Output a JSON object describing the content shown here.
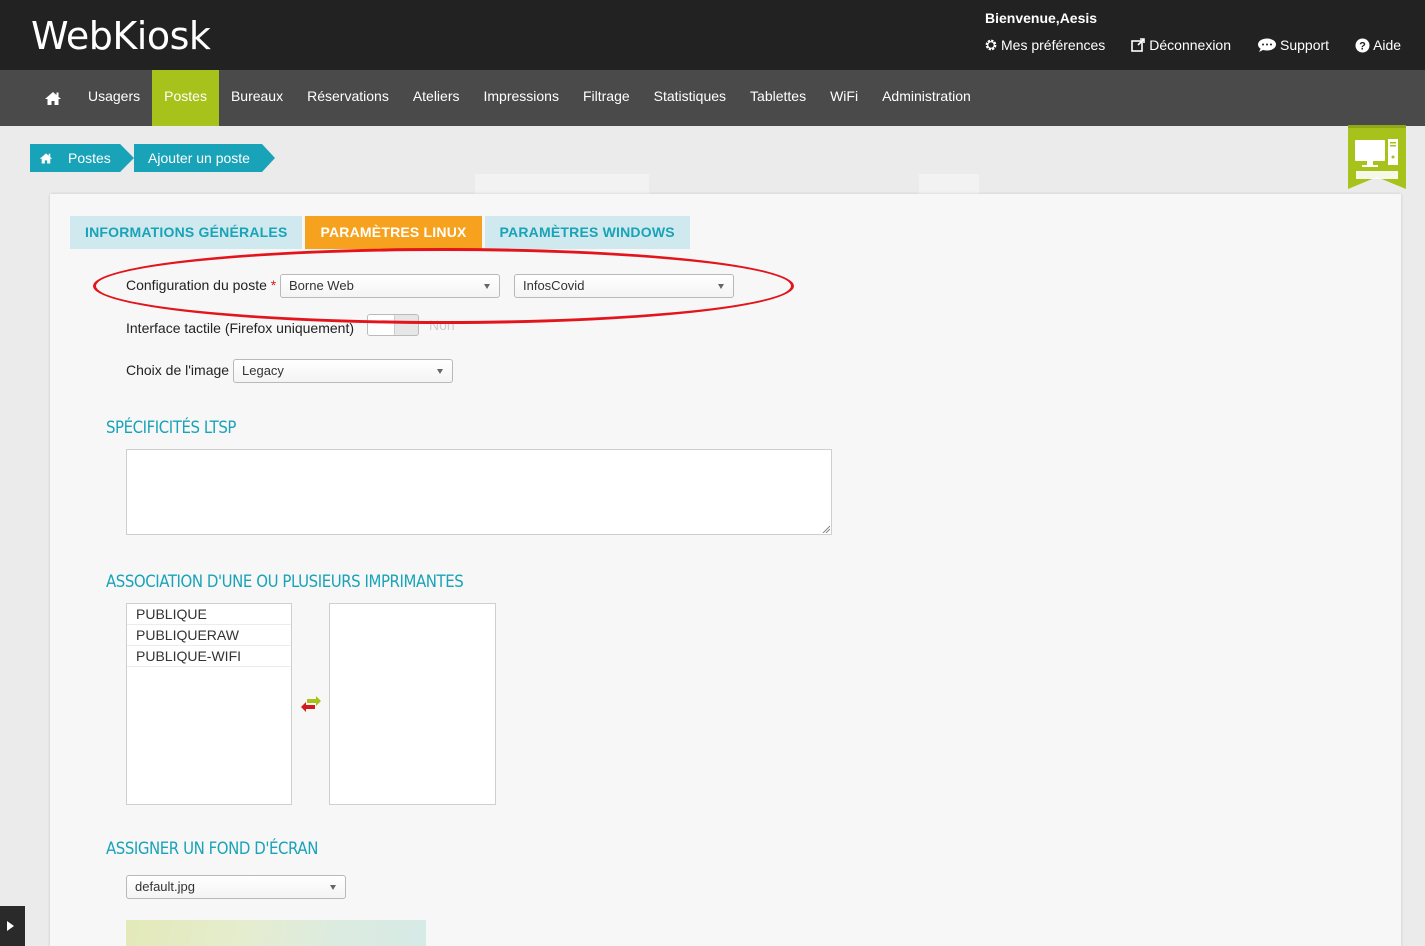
{
  "header": {
    "logo": "WebKiosk",
    "welcome": "Bienvenue,Aesis",
    "links": [
      {
        "label": "Mes préférences",
        "icon": "gear-icon"
      },
      {
        "label": "Déconnexion",
        "icon": "external-link-icon"
      },
      {
        "label": "Support",
        "icon": "chat-icon"
      },
      {
        "label": "Aide",
        "icon": "help-icon"
      }
    ]
  },
  "nav": {
    "items": [
      "Usagers",
      "Postes",
      "Bureaux",
      "Réservations",
      "Ateliers",
      "Impressions",
      "Filtrage",
      "Statistiques",
      "Tablettes",
      "WiFi",
      "Administration"
    ],
    "active": "Postes"
  },
  "breadcrumb": {
    "home": "Postes",
    "current": "Ajouter un poste"
  },
  "tabs": {
    "general": "INFORMATIONS GÉNÉRALES",
    "linux": "PARAMÈTRES LINUX",
    "windows": "PARAMÈTRES WINDOWS",
    "active": "linux"
  },
  "form": {
    "config_label": "Configuration du poste",
    "required_mark": "*",
    "config_value_1": "Borne Web",
    "config_value_2": "InfosCovid",
    "touch_label": "Interface tactile (Firefox uniquement)",
    "touch_state": "Non",
    "image_label": "Choix de l'image",
    "image_value": "Legacy"
  },
  "sections": {
    "ltsp": "Spécificités LTSP",
    "printers": "Association d'une ou plusieurs imprimantes",
    "wallpaper": "Assigner un fond d'écran"
  },
  "printers": {
    "available": [
      "PUBLIQUE",
      "PUBLIQUERAW",
      "PUBLIQUE-WIFI"
    ],
    "assigned": []
  },
  "wallpaper": {
    "value": "default.jpg"
  },
  "colors": {
    "accent": "#19a3b8",
    "nav_active": "#a7c21b",
    "tab_active": "#f7a21e",
    "annotation": "#e3141b"
  }
}
